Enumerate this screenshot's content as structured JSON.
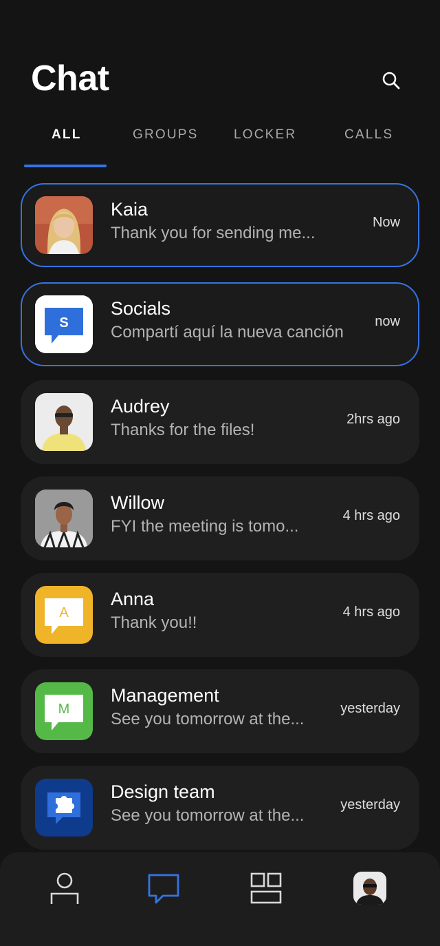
{
  "header": {
    "title": "Chat"
  },
  "tabs": [
    {
      "label": "ALL",
      "active": true
    },
    {
      "label": "GROUPS",
      "active": false
    },
    {
      "label": "LOCKER",
      "active": false
    },
    {
      "label": "CALLS",
      "active": false
    }
  ],
  "chats": [
    {
      "name": "Kaia",
      "message": "Thank you for sending me...",
      "time": "Now",
      "selected": true,
      "avatar": "photo-woman-blonde"
    },
    {
      "name": "Socials",
      "message": "Compartí aquí la nueva canción",
      "time": "now",
      "selected": true,
      "avatar": "group-icon-blue",
      "letter": "S"
    },
    {
      "name": "Audrey",
      "message": "Thanks for the files!",
      "time": "2hrs ago",
      "selected": false,
      "avatar": "photo-man-yellow-shirt"
    },
    {
      "name": "Willow",
      "message": "FYI the meeting is tomo...",
      "time": "4 hrs ago",
      "selected": false,
      "avatar": "photo-man-plaid-shirt"
    },
    {
      "name": "Anna",
      "message": "Thank you!!",
      "time": "4 hrs ago",
      "selected": false,
      "avatar": "letter-icon-yellow",
      "letter": "A"
    },
    {
      "name": "Management",
      "message": "See you tomorrow at the...",
      "time": "yesterday",
      "selected": false,
      "avatar": "letter-icon-green",
      "letter": "M"
    },
    {
      "name": "Design team",
      "message": "See you tomorrow at the...",
      "time": "yesterday",
      "selected": false,
      "avatar": "puzzle-icon-navy"
    }
  ],
  "bottom_nav": {
    "items": [
      {
        "icon": "person-icon",
        "active": false
      },
      {
        "icon": "chat-bubble-icon",
        "active": true
      },
      {
        "icon": "apps-grid-icon",
        "active": false
      },
      {
        "icon": "profile-avatar",
        "active": false
      }
    ]
  },
  "colors": {
    "background": "#141414",
    "card": "#1f1f1f",
    "accent": "#3574e3",
    "text_primary": "#ffffff",
    "text_secondary": "#b3b3b3",
    "socials_icon": "#2f6fdc",
    "anna_icon": "#f0b429",
    "management_icon": "#55b948",
    "design_team_icon": "#0f3b8c"
  }
}
